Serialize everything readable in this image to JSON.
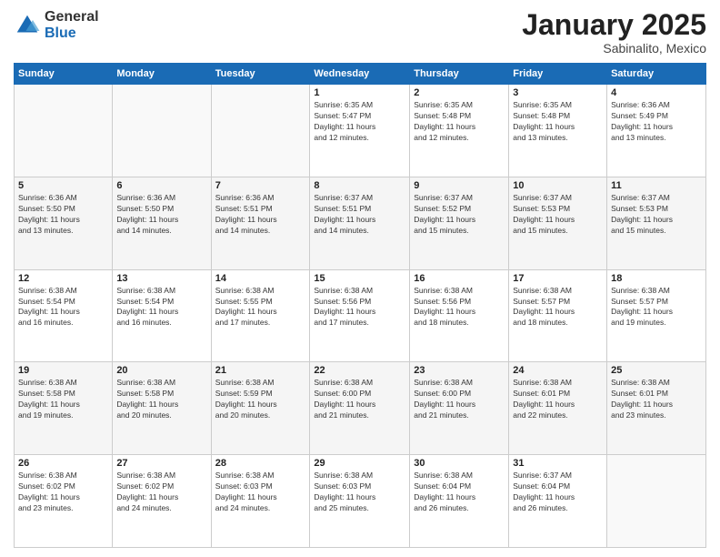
{
  "header": {
    "logo_general": "General",
    "logo_blue": "Blue",
    "month_title": "January 2025",
    "subtitle": "Sabinalito, Mexico"
  },
  "weekdays": [
    "Sunday",
    "Monday",
    "Tuesday",
    "Wednesday",
    "Thursday",
    "Friday",
    "Saturday"
  ],
  "weeks": [
    [
      {
        "day": "",
        "info": ""
      },
      {
        "day": "",
        "info": ""
      },
      {
        "day": "",
        "info": ""
      },
      {
        "day": "1",
        "info": "Sunrise: 6:35 AM\nSunset: 5:47 PM\nDaylight: 11 hours\nand 12 minutes."
      },
      {
        "day": "2",
        "info": "Sunrise: 6:35 AM\nSunset: 5:48 PM\nDaylight: 11 hours\nand 12 minutes."
      },
      {
        "day": "3",
        "info": "Sunrise: 6:35 AM\nSunset: 5:48 PM\nDaylight: 11 hours\nand 13 minutes."
      },
      {
        "day": "4",
        "info": "Sunrise: 6:36 AM\nSunset: 5:49 PM\nDaylight: 11 hours\nand 13 minutes."
      }
    ],
    [
      {
        "day": "5",
        "info": "Sunrise: 6:36 AM\nSunset: 5:50 PM\nDaylight: 11 hours\nand 13 minutes."
      },
      {
        "day": "6",
        "info": "Sunrise: 6:36 AM\nSunset: 5:50 PM\nDaylight: 11 hours\nand 14 minutes."
      },
      {
        "day": "7",
        "info": "Sunrise: 6:36 AM\nSunset: 5:51 PM\nDaylight: 11 hours\nand 14 minutes."
      },
      {
        "day": "8",
        "info": "Sunrise: 6:37 AM\nSunset: 5:51 PM\nDaylight: 11 hours\nand 14 minutes."
      },
      {
        "day": "9",
        "info": "Sunrise: 6:37 AM\nSunset: 5:52 PM\nDaylight: 11 hours\nand 15 minutes."
      },
      {
        "day": "10",
        "info": "Sunrise: 6:37 AM\nSunset: 5:53 PM\nDaylight: 11 hours\nand 15 minutes."
      },
      {
        "day": "11",
        "info": "Sunrise: 6:37 AM\nSunset: 5:53 PM\nDaylight: 11 hours\nand 15 minutes."
      }
    ],
    [
      {
        "day": "12",
        "info": "Sunrise: 6:38 AM\nSunset: 5:54 PM\nDaylight: 11 hours\nand 16 minutes."
      },
      {
        "day": "13",
        "info": "Sunrise: 6:38 AM\nSunset: 5:54 PM\nDaylight: 11 hours\nand 16 minutes."
      },
      {
        "day": "14",
        "info": "Sunrise: 6:38 AM\nSunset: 5:55 PM\nDaylight: 11 hours\nand 17 minutes."
      },
      {
        "day": "15",
        "info": "Sunrise: 6:38 AM\nSunset: 5:56 PM\nDaylight: 11 hours\nand 17 minutes."
      },
      {
        "day": "16",
        "info": "Sunrise: 6:38 AM\nSunset: 5:56 PM\nDaylight: 11 hours\nand 18 minutes."
      },
      {
        "day": "17",
        "info": "Sunrise: 6:38 AM\nSunset: 5:57 PM\nDaylight: 11 hours\nand 18 minutes."
      },
      {
        "day": "18",
        "info": "Sunrise: 6:38 AM\nSunset: 5:57 PM\nDaylight: 11 hours\nand 19 minutes."
      }
    ],
    [
      {
        "day": "19",
        "info": "Sunrise: 6:38 AM\nSunset: 5:58 PM\nDaylight: 11 hours\nand 19 minutes."
      },
      {
        "day": "20",
        "info": "Sunrise: 6:38 AM\nSunset: 5:58 PM\nDaylight: 11 hours\nand 20 minutes."
      },
      {
        "day": "21",
        "info": "Sunrise: 6:38 AM\nSunset: 5:59 PM\nDaylight: 11 hours\nand 20 minutes."
      },
      {
        "day": "22",
        "info": "Sunrise: 6:38 AM\nSunset: 6:00 PM\nDaylight: 11 hours\nand 21 minutes."
      },
      {
        "day": "23",
        "info": "Sunrise: 6:38 AM\nSunset: 6:00 PM\nDaylight: 11 hours\nand 21 minutes."
      },
      {
        "day": "24",
        "info": "Sunrise: 6:38 AM\nSunset: 6:01 PM\nDaylight: 11 hours\nand 22 minutes."
      },
      {
        "day": "25",
        "info": "Sunrise: 6:38 AM\nSunset: 6:01 PM\nDaylight: 11 hours\nand 23 minutes."
      }
    ],
    [
      {
        "day": "26",
        "info": "Sunrise: 6:38 AM\nSunset: 6:02 PM\nDaylight: 11 hours\nand 23 minutes."
      },
      {
        "day": "27",
        "info": "Sunrise: 6:38 AM\nSunset: 6:02 PM\nDaylight: 11 hours\nand 24 minutes."
      },
      {
        "day": "28",
        "info": "Sunrise: 6:38 AM\nSunset: 6:03 PM\nDaylight: 11 hours\nand 24 minutes."
      },
      {
        "day": "29",
        "info": "Sunrise: 6:38 AM\nSunset: 6:03 PM\nDaylight: 11 hours\nand 25 minutes."
      },
      {
        "day": "30",
        "info": "Sunrise: 6:38 AM\nSunset: 6:04 PM\nDaylight: 11 hours\nand 26 minutes."
      },
      {
        "day": "31",
        "info": "Sunrise: 6:37 AM\nSunset: 6:04 PM\nDaylight: 11 hours\nand 26 minutes."
      },
      {
        "day": "",
        "info": ""
      }
    ]
  ]
}
